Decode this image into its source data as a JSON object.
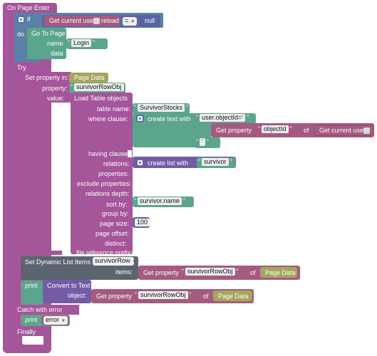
{
  "event": {
    "title": "On Page Enter"
  },
  "if_block": {
    "if_label": "if",
    "do_label": "do",
    "condition": {
      "left_label": "Get current user",
      "left_option": "reload",
      "operator": "=",
      "right_value": "null"
    },
    "goto": {
      "title": "Go To Page",
      "name_label": "name",
      "name_value": "Login",
      "data_label": "data"
    }
  },
  "try_block": {
    "title": "Try",
    "catch_title": "Catch with error",
    "finally_title": "Finally"
  },
  "set_property": {
    "title": "Set property in:",
    "target": "Page Data",
    "property_label": "property:",
    "property_value": "survivorRowObj",
    "value_label": "value:"
  },
  "load_table": {
    "title": "Load Table objects",
    "table_name_label": "table name:",
    "table_name_value": "SurvivorStocks",
    "where_label": "where clause:",
    "create_text_label": "create text with",
    "where_text1": "user.objectId='",
    "get_property_label": "Get property",
    "where_prop": "objectId",
    "of_label": "of",
    "where_obj": "Get current user",
    "where_obj_option": "reload",
    "where_text2": "'",
    "having_label": "having clause:",
    "relations_label": "relations:",
    "create_list_label": "create list with",
    "relations_value": "survivor",
    "properties_label": "properties:",
    "exclude_label": "exclude properties:",
    "depth_label": "relations depth:",
    "sortby_label": "sort by:",
    "sortby_value": "survivor.name",
    "groupby_label": "group by:",
    "pagesize_label": "page size:",
    "pagesize_value": "100",
    "offset_label": "page offset:",
    "distinct_label": "distinct:",
    "fileref_label": "file reference prefix:"
  },
  "dynamic_list": {
    "title": "Set Dynamic List Items to",
    "target": "survivorRow",
    "items_label": "items:",
    "get_property_label": "Get property",
    "prop": "survivorRowObj",
    "of_label": "of",
    "obj": "Page Data"
  },
  "print1": {
    "label": "print",
    "convert_label": "Convert to Text",
    "object_label": "object:",
    "get_property_label": "Get property",
    "prop": "survivorRowObj",
    "of_label": "of",
    "obj": "Page Data"
  },
  "print2": {
    "label": "print",
    "value": "error"
  },
  "colors": {
    "event": "#a5559a",
    "control": "#5b80a5",
    "logic": "#5b67a5",
    "ui": "#5ba58c",
    "try": "#a5745b",
    "text": "#5ba58c",
    "backendless": "#a55b80",
    "pagedata": "#a5a55b",
    "dynlist": "#5b6570"
  }
}
